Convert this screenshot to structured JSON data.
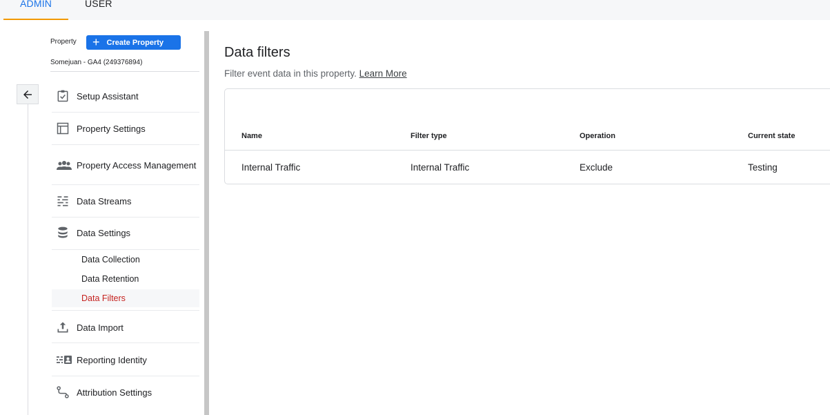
{
  "top_tabs": {
    "admin": "ADMIN",
    "user": "USER"
  },
  "property": {
    "label": "Property",
    "create_button": "Create Property",
    "name": "Somejuan - GA4 (249376894)"
  },
  "nav": {
    "items": [
      {
        "label": "Setup Assistant",
        "icon": "checkbox-clipboard-icon"
      },
      {
        "label": "Property Settings",
        "icon": "layout-panel-icon"
      },
      {
        "label": "Property Access Management",
        "icon": "people-icon"
      },
      {
        "label": "Data Streams",
        "icon": "streams-icon"
      },
      {
        "label": "Data Settings",
        "icon": "database-icon"
      },
      {
        "label": "Data Import",
        "icon": "upload-icon"
      },
      {
        "label": "Reporting Identity",
        "icon": "identity-card-icon"
      },
      {
        "label": "Attribution Settings",
        "icon": "attribution-path-icon"
      }
    ],
    "data_settings_sub": [
      {
        "label": "Data Collection",
        "active": false
      },
      {
        "label": "Data Retention",
        "active": false
      },
      {
        "label": "Data Filters",
        "active": true
      }
    ]
  },
  "main": {
    "title": "Data filters",
    "description": "Filter event data in this property.",
    "learn_more": "Learn More",
    "table": {
      "columns": [
        "Name",
        "Filter type",
        "Operation",
        "Current state"
      ],
      "rows": [
        [
          "Internal Traffic",
          "Internal Traffic",
          "Exclude",
          "Testing"
        ]
      ]
    }
  },
  "colors": {
    "accent": "#1a73e8",
    "tab_indicator": "#f29900",
    "active_sub_item": "#c5221f"
  }
}
